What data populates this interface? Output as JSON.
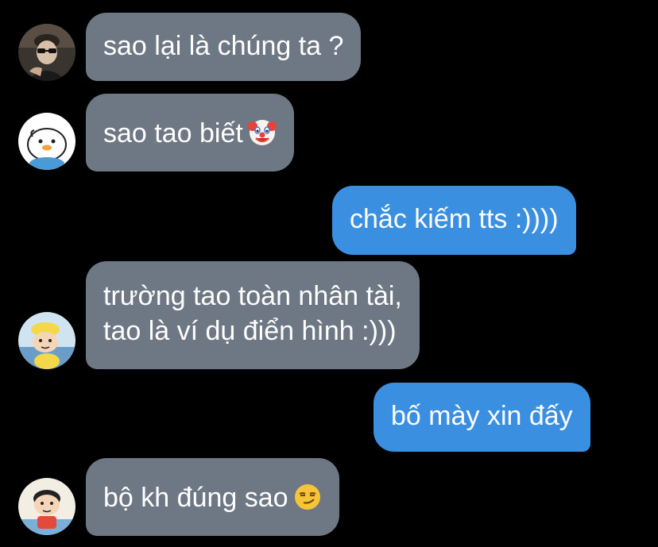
{
  "messages": [
    {
      "sender": "incoming",
      "text": "sao lại là chúng ta ?"
    },
    {
      "sender": "incoming",
      "text": "sao tao biết",
      "emoji": "clown-face-emoji"
    },
    {
      "sender": "outgoing",
      "text": "chắc kiếm tts :))))"
    },
    {
      "sender": "incoming",
      "line1": "trường tao toàn nhân tài,",
      "line2": "tao là ví dụ điển hình :)))"
    },
    {
      "sender": "outgoing",
      "text": "bố mày xin đấy"
    },
    {
      "sender": "incoming",
      "text": "bộ kh đúng sao",
      "emoji": "smirking-face-emoji"
    }
  ],
  "avatars": [
    "person-with-sunglasses-avatar",
    "white-bird-avatar",
    "cartoon-boy-yellow-hat-avatar",
    "cartoon-boy-avatar"
  ],
  "colors": {
    "background": "#000000",
    "incoming_bubble": "#6e7884",
    "outgoing_bubble": "#3b8fe0",
    "text": "#ffffff"
  }
}
